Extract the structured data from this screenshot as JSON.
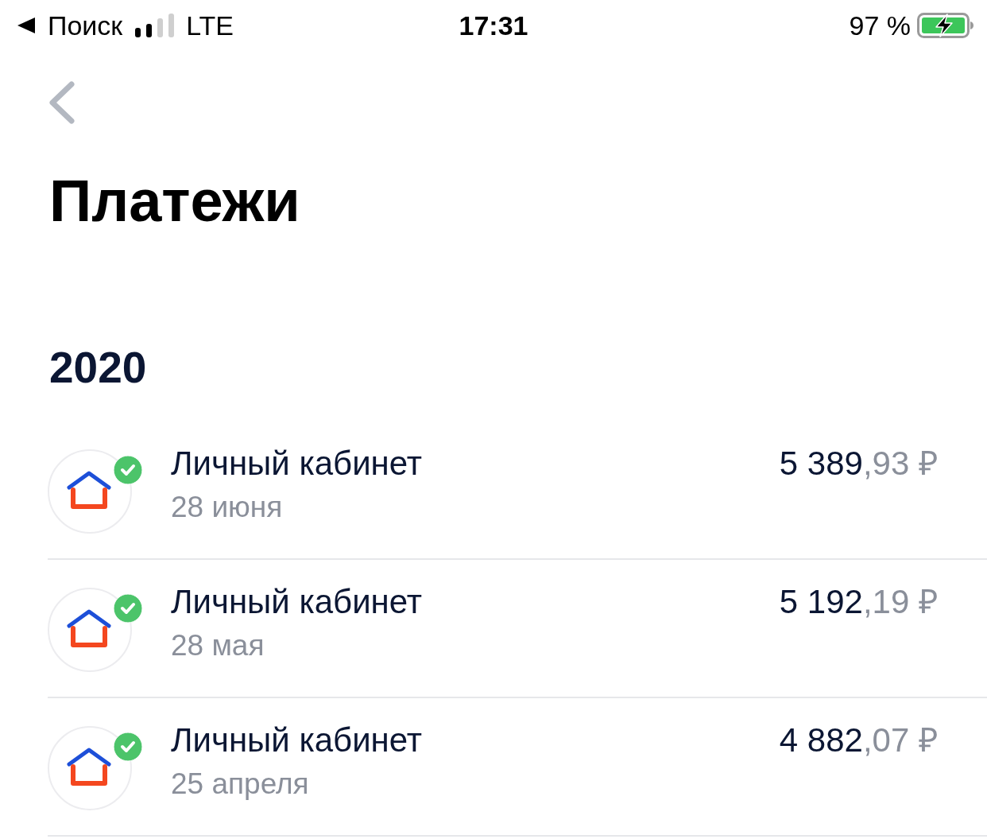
{
  "status_bar": {
    "back_label": "Поиск",
    "network": "LTE",
    "time": "17:31",
    "battery": "97 %"
  },
  "title": "Платежи",
  "sections": [
    {
      "year": "2020",
      "payments": [
        {
          "title": "Личный кабинет",
          "date": "28 июня",
          "amount": "5 389",
          "amount_fraction": ",93 ₽",
          "completed": true
        },
        {
          "title": "Личный кабинет",
          "date": "28 мая",
          "amount": "5 192",
          "amount_fraction": ",19 ₽",
          "completed": true
        },
        {
          "title": "Личный кабинет",
          "date": "25 апреля",
          "amount": "4 882",
          "amount_fraction": ",07 ₽",
          "completed": true
        }
      ]
    }
  ]
}
